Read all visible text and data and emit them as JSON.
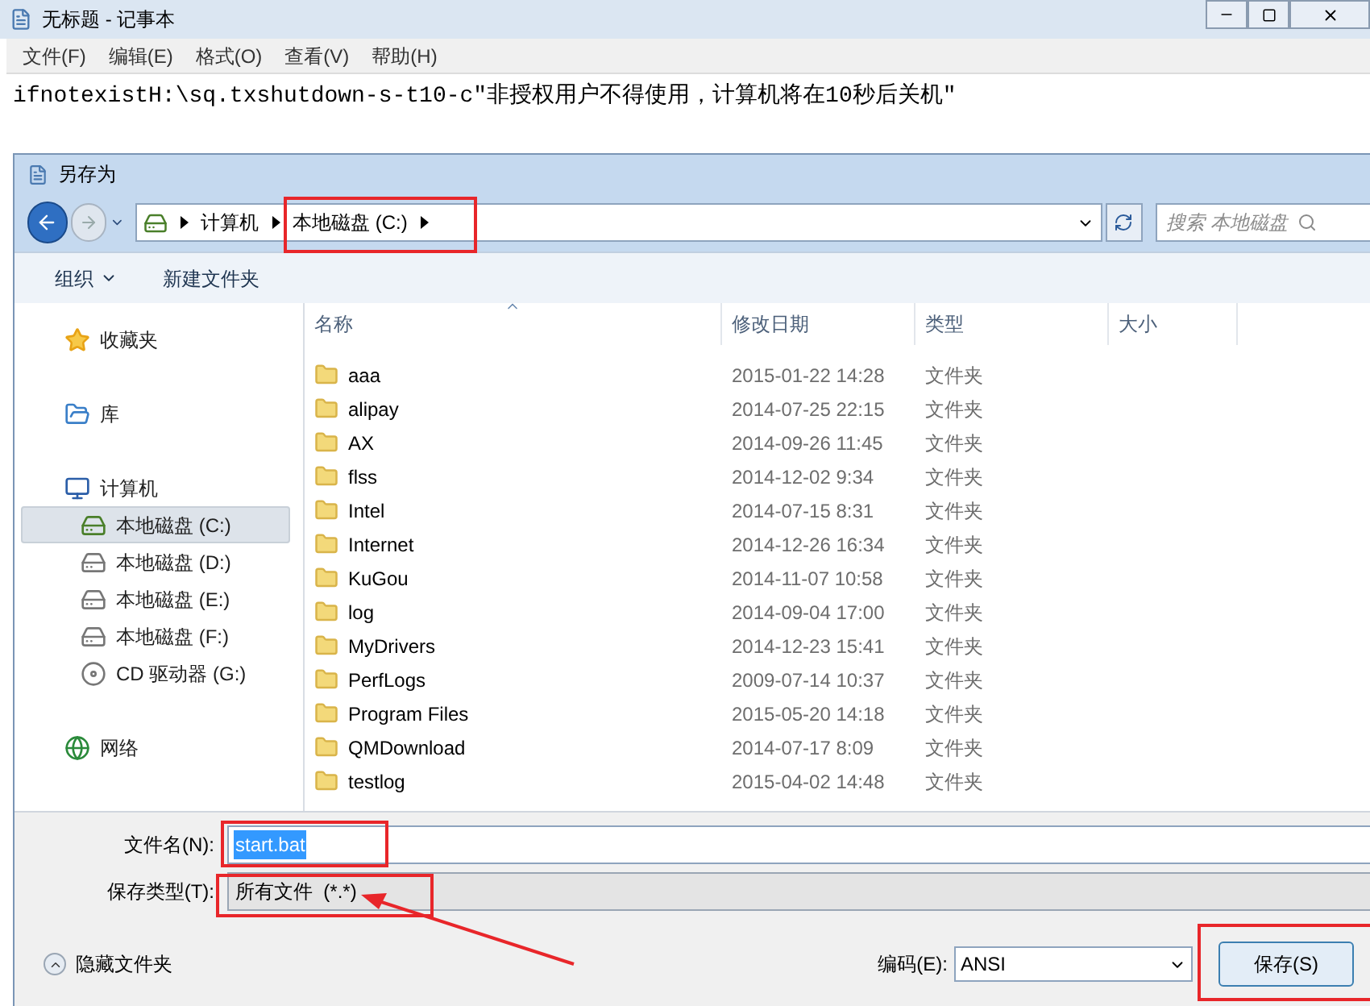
{
  "notepad": {
    "title": "无标题 - 记事本",
    "menu": [
      "文件(F)",
      "编辑(E)",
      "格式(O)",
      "查看(V)",
      "帮助(H)"
    ],
    "text": "ifnotexistH:\\sq.txshutdown-s-t10-c″非授权用户不得使用，计算机将在10秒后关机″"
  },
  "dialog": {
    "title": "另存为",
    "breadcrumb": [
      "计算机",
      "本地磁盘 (C:)"
    ],
    "search_placeholder": "搜索 本地磁盘",
    "organize": "组织",
    "new_folder": "新建文件夹",
    "sidebar": [
      {
        "label": "收藏夹",
        "kind": "favorites",
        "selected": false
      },
      {
        "label": "库",
        "kind": "library",
        "selected": false
      },
      {
        "label": "计算机",
        "kind": "computer",
        "selected": false,
        "children": [
          {
            "label": "本地磁盘 (C:)",
            "kind": "system_drive",
            "selected": true
          },
          {
            "label": "本地磁盘 (D:)",
            "kind": "drive",
            "selected": false
          },
          {
            "label": "本地磁盘 (E:)",
            "kind": "drive",
            "selected": false
          },
          {
            "label": "本地磁盘 (F:)",
            "kind": "drive",
            "selected": false
          },
          {
            "label": "CD 驱动器 (G:)",
            "kind": "cd_drive",
            "selected": false
          }
        ]
      },
      {
        "label": "网络",
        "kind": "network",
        "selected": false
      }
    ],
    "columns": [
      {
        "label": "名称",
        "sorted": true
      },
      {
        "label": "修改日期",
        "sorted": false
      },
      {
        "label": "类型",
        "sorted": false
      },
      {
        "label": "大小",
        "sorted": false
      }
    ],
    "rows": [
      {
        "name": "aaa",
        "date": "2015-01-22 14:28",
        "type": "文件夹"
      },
      {
        "name": "alipay",
        "date": "2014-07-25 22:15",
        "type": "文件夹"
      },
      {
        "name": "AX",
        "date": "2014-09-26 11:45",
        "type": "文件夹"
      },
      {
        "name": "flss",
        "date": "2014-12-02 9:34",
        "type": "文件夹"
      },
      {
        "name": "Intel",
        "date": "2014-07-15 8:31",
        "type": "文件夹"
      },
      {
        "name": "Internet",
        "date": "2014-12-26 16:34",
        "type": "文件夹"
      },
      {
        "name": "KuGou",
        "date": "2014-11-07 10:58",
        "type": "文件夹"
      },
      {
        "name": "log",
        "date": "2014-09-04 17:00",
        "type": "文件夹"
      },
      {
        "name": "MyDrivers",
        "date": "2014-12-23 15:41",
        "type": "文件夹"
      },
      {
        "name": "PerfLogs",
        "date": "2009-07-14 10:37",
        "type": "文件夹"
      },
      {
        "name": "Program Files",
        "date": "2015-05-20 14:18",
        "type": "文件夹"
      },
      {
        "name": "QMDownload",
        "date": "2014-07-17 8:09",
        "type": "文件夹"
      },
      {
        "name": "testlog",
        "date": "2015-04-02 14:48",
        "type": "文件夹"
      }
    ],
    "file_name": {
      "label": "文件名(N):",
      "value": "start.bat",
      "text_selected": true
    },
    "file_type": {
      "label": "保存类型(T):",
      "value": "所有文件  (*.*)"
    },
    "hide_folders": "隐藏文件夹",
    "encoding": {
      "label": "编码(E):",
      "value": "ANSI"
    },
    "save_button": "保存(S)"
  }
}
